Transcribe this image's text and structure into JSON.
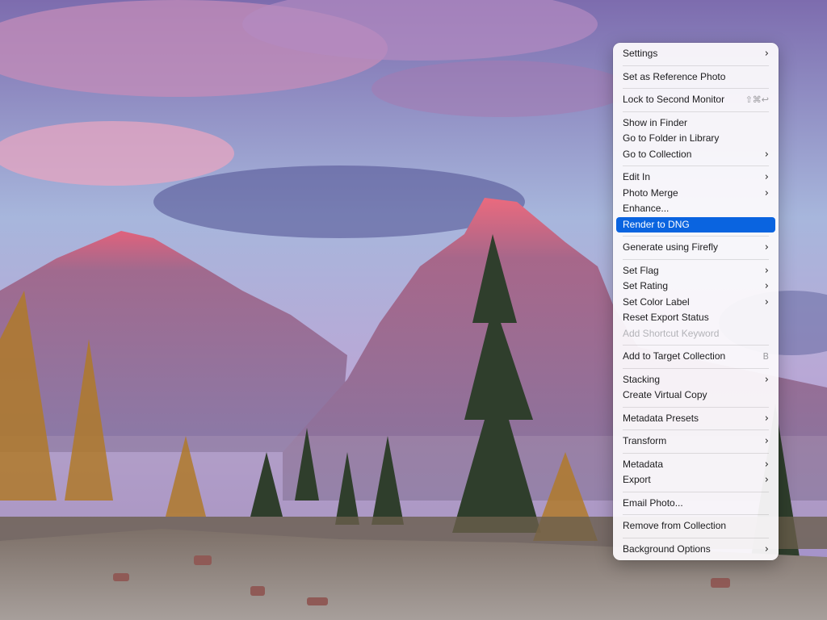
{
  "colors": {
    "menu_highlight": "#0a64e0",
    "menu_text": "#1c1c1e",
    "menu_disabled_text": "#b3b3b8"
  },
  "background": {
    "description_icon": "photo-canvas"
  },
  "menu": {
    "groups": [
      [
        {
          "label": "Settings",
          "submenu": true
        }
      ],
      [
        {
          "label": "Set as Reference Photo"
        }
      ],
      [
        {
          "label": "Lock to Second Monitor",
          "shortcut": "⇧⌘↩"
        }
      ],
      [
        {
          "label": "Show in Finder"
        },
        {
          "label": "Go to Folder in Library"
        },
        {
          "label": "Go to Collection",
          "submenu": true
        }
      ],
      [
        {
          "label": "Edit In",
          "submenu": true
        },
        {
          "label": "Photo Merge",
          "submenu": true
        },
        {
          "label": "Enhance..."
        },
        {
          "label": "Render to DNG",
          "highlighted": true
        }
      ],
      [
        {
          "label": "Generate using Firefly",
          "submenu": true
        }
      ],
      [
        {
          "label": "Set Flag",
          "submenu": true
        },
        {
          "label": "Set Rating",
          "submenu": true
        },
        {
          "label": "Set Color Label",
          "submenu": true
        },
        {
          "label": "Reset Export Status"
        },
        {
          "label": "Add Shortcut Keyword",
          "disabled": true
        }
      ],
      [
        {
          "label": "Add to Target Collection",
          "shortcut": "B"
        }
      ],
      [
        {
          "label": "Stacking",
          "submenu": true
        },
        {
          "label": "Create Virtual Copy"
        }
      ],
      [
        {
          "label": "Metadata Presets",
          "submenu": true
        }
      ],
      [
        {
          "label": "Transform",
          "submenu": true
        }
      ],
      [
        {
          "label": "Metadata",
          "submenu": true
        },
        {
          "label": "Export",
          "submenu": true
        }
      ],
      [
        {
          "label": "Email Photo..."
        }
      ],
      [
        {
          "label": "Remove from Collection"
        }
      ],
      [
        {
          "label": "Background Options",
          "submenu": true
        }
      ]
    ],
    "submenu_icon": "chevron-right-icon",
    "submenu_glyph": "›"
  }
}
